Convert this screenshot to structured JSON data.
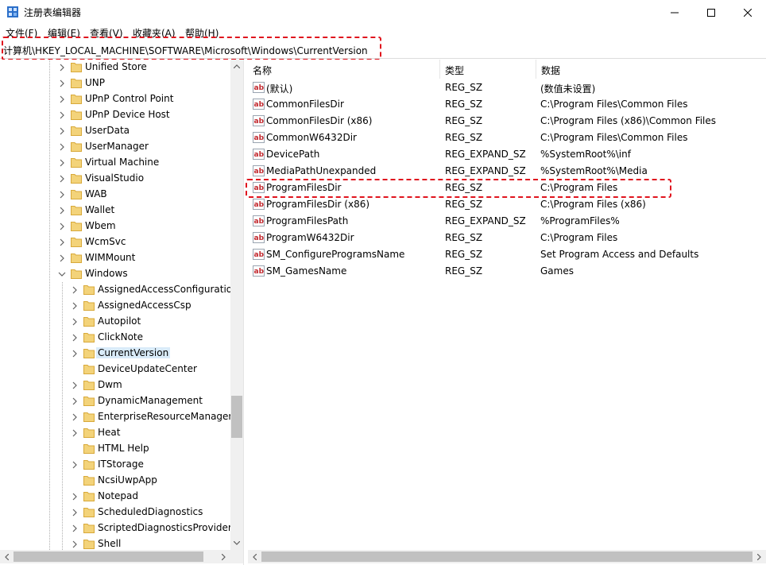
{
  "window": {
    "title": "注册表编辑器",
    "colors": {
      "highlight_box": "#e0141e",
      "selected_bg": "#d9ebf9",
      "folder": "#f3d37a"
    }
  },
  "menu": [
    {
      "label": "文件(F)"
    },
    {
      "label": "编辑(E)"
    },
    {
      "label": "查看(V)"
    },
    {
      "label": "收藏夹(A)"
    },
    {
      "label": "帮助(H)"
    }
  ],
  "address": {
    "path": "计算机\\HKEY_LOCAL_MACHINE\\SOFTWARE\\Microsoft\\Windows\\CurrentVersion"
  },
  "tree": {
    "items": [
      {
        "label": "Unified Store",
        "level": 1,
        "expander": "right"
      },
      {
        "label": "UNP",
        "level": 1,
        "expander": "right"
      },
      {
        "label": "UPnP Control Point",
        "level": 1,
        "expander": "right"
      },
      {
        "label": "UPnP Device Host",
        "level": 1,
        "expander": "right"
      },
      {
        "label": "UserData",
        "level": 1,
        "expander": "right"
      },
      {
        "label": "UserManager",
        "level": 1,
        "expander": "right"
      },
      {
        "label": "Virtual Machine",
        "level": 1,
        "expander": "right"
      },
      {
        "label": "VisualStudio",
        "level": 1,
        "expander": "right"
      },
      {
        "label": "WAB",
        "level": 1,
        "expander": "right"
      },
      {
        "label": "Wallet",
        "level": 1,
        "expander": "right"
      },
      {
        "label": "Wbem",
        "level": 1,
        "expander": "right"
      },
      {
        "label": "WcmSvc",
        "level": 1,
        "expander": "right"
      },
      {
        "label": "WIMMount",
        "level": 1,
        "expander": "right"
      },
      {
        "label": "Windows",
        "level": 1,
        "expander": "down"
      },
      {
        "label": "AssignedAccessConfiguratio",
        "level": 2,
        "expander": "right"
      },
      {
        "label": "AssignedAccessCsp",
        "level": 2,
        "expander": "right"
      },
      {
        "label": "Autopilot",
        "level": 2,
        "expander": "right"
      },
      {
        "label": "ClickNote",
        "level": 2,
        "expander": "right"
      },
      {
        "label": "CurrentVersion",
        "level": 2,
        "expander": "right",
        "selected": true
      },
      {
        "label": "DeviceUpdateCenter",
        "level": 2,
        "expander": "none"
      },
      {
        "label": "Dwm",
        "level": 2,
        "expander": "right"
      },
      {
        "label": "DynamicManagement",
        "level": 2,
        "expander": "right"
      },
      {
        "label": "EnterpriseResourceManager",
        "level": 2,
        "expander": "right"
      },
      {
        "label": "Heat",
        "level": 2,
        "expander": "right"
      },
      {
        "label": "HTML Help",
        "level": 2,
        "expander": "none"
      },
      {
        "label": "ITStorage",
        "level": 2,
        "expander": "right"
      },
      {
        "label": "NcsiUwpApp",
        "level": 2,
        "expander": "none"
      },
      {
        "label": "Notepad",
        "level": 2,
        "expander": "right"
      },
      {
        "label": "ScheduledDiagnostics",
        "level": 2,
        "expander": "right"
      },
      {
        "label": "ScriptedDiagnosticsProvider",
        "level": 2,
        "expander": "right"
      },
      {
        "label": "Shell",
        "level": 2,
        "expander": "right"
      }
    ]
  },
  "list": {
    "columns": [
      {
        "label": "名称"
      },
      {
        "label": "类型"
      },
      {
        "label": "数据"
      }
    ],
    "rows": [
      {
        "name": "(默认)",
        "type": "REG_SZ",
        "data": "(数值未设置)"
      },
      {
        "name": "CommonFilesDir",
        "type": "REG_SZ",
        "data": "C:\\Program Files\\Common Files"
      },
      {
        "name": "CommonFilesDir (x86)",
        "type": "REG_SZ",
        "data": "C:\\Program Files (x86)\\Common Files"
      },
      {
        "name": "CommonW6432Dir",
        "type": "REG_SZ",
        "data": "C:\\Program Files\\Common Files"
      },
      {
        "name": "DevicePath",
        "type": "REG_EXPAND_SZ",
        "data": "%SystemRoot%\\inf"
      },
      {
        "name": "MediaPathUnexpanded",
        "type": "REG_EXPAND_SZ",
        "data": "%SystemRoot%\\Media"
      },
      {
        "name": "ProgramFilesDir",
        "type": "REG_SZ",
        "data": "C:\\Program Files",
        "highlighted": true
      },
      {
        "name": "ProgramFilesDir (x86)",
        "type": "REG_SZ",
        "data": "C:\\Program Files (x86)"
      },
      {
        "name": "ProgramFilesPath",
        "type": "REG_EXPAND_SZ",
        "data": "%ProgramFiles%"
      },
      {
        "name": "ProgramW6432Dir",
        "type": "REG_SZ",
        "data": "C:\\Program Files"
      },
      {
        "name": "SM_ConfigureProgramsName",
        "type": "REG_SZ",
        "data": "Set Program Access and Defaults"
      },
      {
        "name": "SM_GamesName",
        "type": "REG_SZ",
        "data": "Games"
      }
    ]
  }
}
